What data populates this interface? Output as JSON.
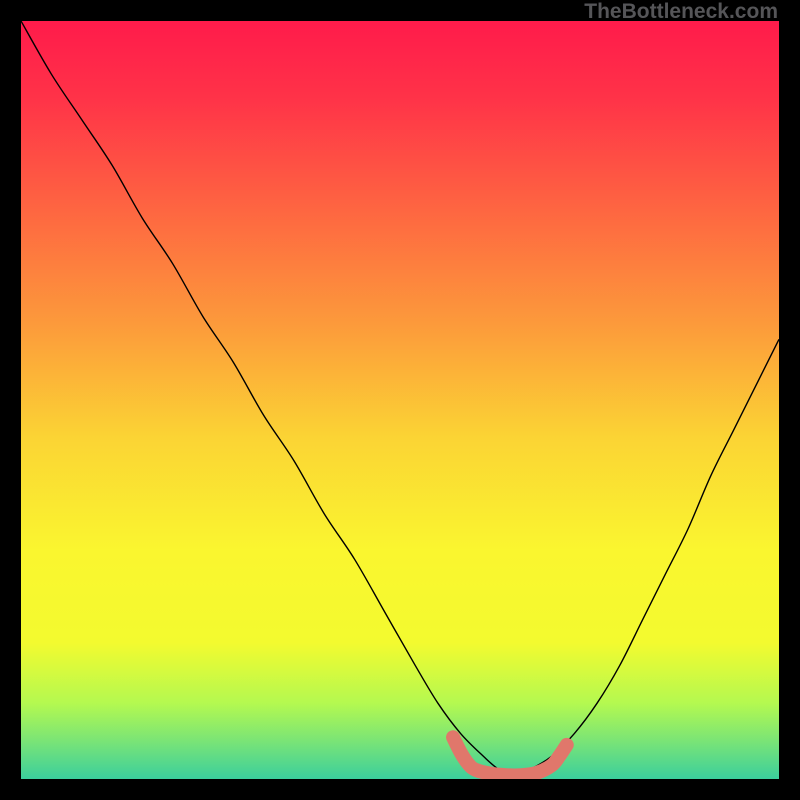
{
  "watermark": "TheBottleneck.com",
  "chart_data": {
    "type": "line",
    "title": "",
    "xlabel": "",
    "ylabel": "",
    "xlim": [
      0,
      100
    ],
    "ylim": [
      0,
      100
    ],
    "grid": false,
    "background_gradient": {
      "stops": [
        {
          "offset": 0.0,
          "color": "#ff1b4b"
        },
        {
          "offset": 0.1,
          "color": "#ff3248"
        },
        {
          "offset": 0.25,
          "color": "#fe6641"
        },
        {
          "offset": 0.4,
          "color": "#fc9a3b"
        },
        {
          "offset": 0.55,
          "color": "#fbd434"
        },
        {
          "offset": 0.7,
          "color": "#faf62f"
        },
        {
          "offset": 0.82,
          "color": "#f3fa2f"
        },
        {
          "offset": 0.9,
          "color": "#b4f950"
        },
        {
          "offset": 0.95,
          "color": "#7ae476"
        },
        {
          "offset": 1.0,
          "color": "#3bcf9d"
        }
      ]
    },
    "series": [
      {
        "name": "bottleneck-curve",
        "color": "#000000",
        "stroke_width": 1.4,
        "x": [
          0,
          4,
          8,
          12,
          16,
          20,
          24,
          28,
          32,
          36,
          40,
          44,
          48,
          52,
          55,
          58,
          61,
          63,
          65,
          67,
          70,
          73,
          76,
          79,
          82,
          85,
          88,
          91,
          94,
          97,
          100
        ],
        "y": [
          100,
          93,
          87,
          81,
          74,
          68,
          61,
          55,
          48,
          42,
          35,
          29,
          22,
          15,
          10,
          6,
          3,
          1.3,
          0.6,
          1.2,
          3,
          6,
          10,
          15,
          21,
          27,
          33,
          40,
          46,
          52,
          58
        ]
      },
      {
        "name": "optimal-band",
        "color": "#e0776b",
        "stroke_width": 14,
        "linecap": "round",
        "x": [
          57,
          58,
          59,
          60,
          62,
          64,
          66,
          68,
          70,
          71,
          72
        ],
        "y": [
          5.5,
          3.5,
          2.0,
          1.2,
          0.7,
          0.5,
          0.5,
          0.8,
          1.8,
          3.0,
          4.5
        ]
      }
    ]
  }
}
